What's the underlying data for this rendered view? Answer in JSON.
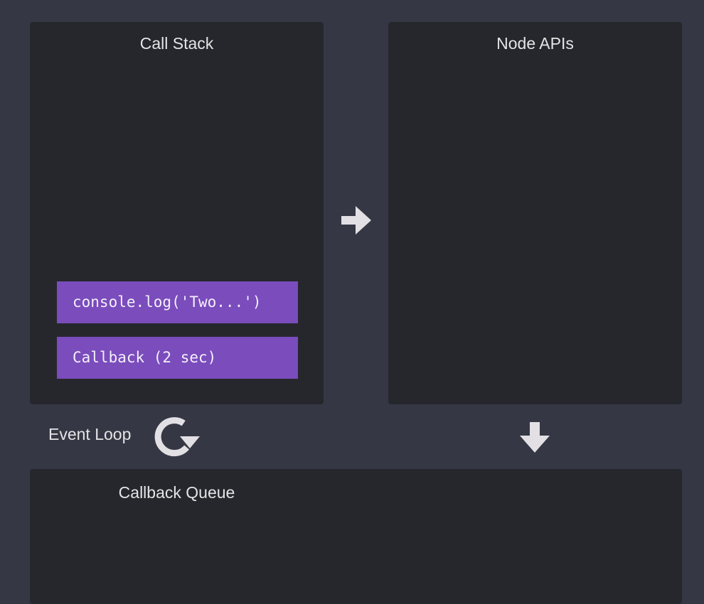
{
  "call_stack": {
    "title": "Call Stack",
    "frames": [
      {
        "label": "console.log('Two...')"
      },
      {
        "label": "Callback (2 sec)"
      }
    ]
  },
  "node_apis": {
    "title": "Node APIs"
  },
  "event_loop": {
    "label": "Event Loop",
    "icon": "refresh-icon"
  },
  "callback_queue": {
    "title": "Callback Queue"
  },
  "colors": {
    "background": "#353844",
    "panel": "#26272c",
    "frame": "#7a4cbc",
    "arrow": "#e2e0e4"
  }
}
